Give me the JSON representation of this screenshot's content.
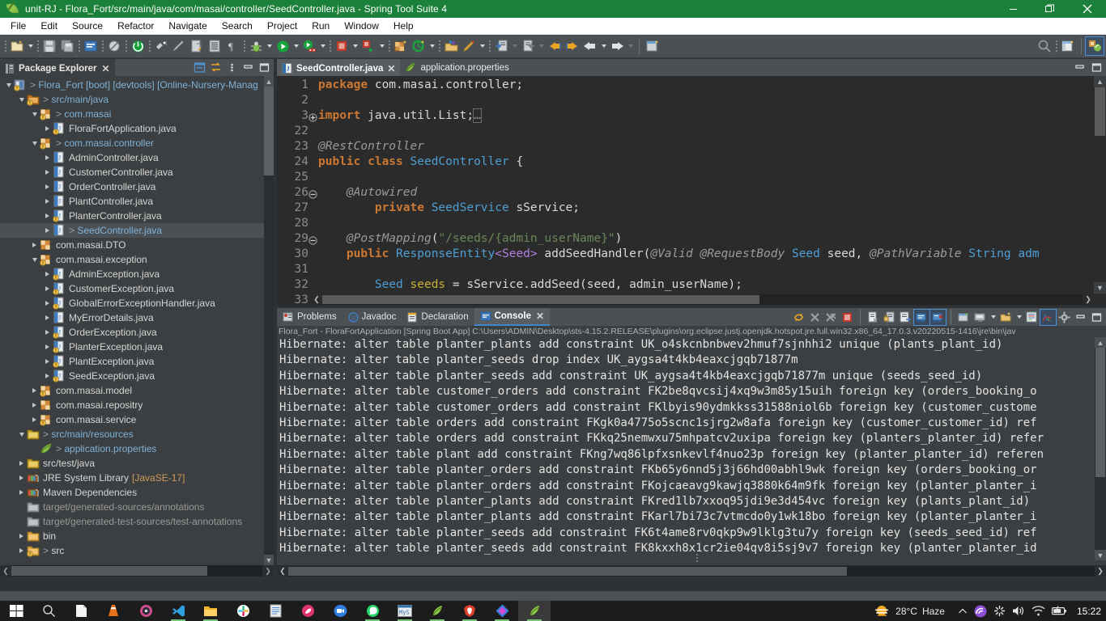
{
  "window": {
    "title": "unit-RJ - Flora_Fort/src/main/java/com/masai/controller/SeedController.java - Spring Tool Suite 4",
    "minimize": "—",
    "restore": "❐",
    "close": "✕"
  },
  "menu": [
    "File",
    "Edit",
    "Source",
    "Refactor",
    "Navigate",
    "Search",
    "Project",
    "Run",
    "Window",
    "Help"
  ],
  "package_explorer": {
    "tab_label": "Package Explorer",
    "close_label": "✕",
    "tree": [
      {
        "depth": 0,
        "twisty": "down",
        "icon": "project",
        "label": "Flora_Fort [boot] [devtools] [Online-Nursery-Manag",
        "style": "link",
        "dirty": true
      },
      {
        "depth": 1,
        "twisty": "down",
        "icon": "srcfolder",
        "label": "src/main/java",
        "style": "link",
        "dirty": true
      },
      {
        "depth": 2,
        "twisty": "down",
        "icon": "pkg-warn",
        "label": "com.masai",
        "style": "link",
        "dirty": true
      },
      {
        "depth": 3,
        "twisty": "right",
        "icon": "java-warn",
        "label": "FloraFortApplication.java",
        "style": "plain",
        "dirty": false
      },
      {
        "depth": 2,
        "twisty": "down",
        "icon": "pkg-warn",
        "label": "com.masai.controller",
        "style": "link",
        "dirty": true
      },
      {
        "depth": 3,
        "twisty": "right",
        "icon": "java",
        "label": "AdminController.java",
        "style": "plain",
        "dirty": false
      },
      {
        "depth": 3,
        "twisty": "right",
        "icon": "java",
        "label": "CustomerController.java",
        "style": "plain",
        "dirty": false
      },
      {
        "depth": 3,
        "twisty": "right",
        "icon": "java",
        "label": "OrderController.java",
        "style": "plain",
        "dirty": false
      },
      {
        "depth": 3,
        "twisty": "right",
        "icon": "java",
        "label": "PlantController.java",
        "style": "plain",
        "dirty": false
      },
      {
        "depth": 3,
        "twisty": "right",
        "icon": "java-warn",
        "label": "PlanterController.java",
        "style": "plain",
        "dirty": false
      },
      {
        "depth": 3,
        "twisty": "right",
        "icon": "java",
        "label": "SeedController.java",
        "style": "link",
        "dirty": true,
        "selected": true
      },
      {
        "depth": 2,
        "twisty": "right",
        "icon": "pkg",
        "label": "com.masai.DTO",
        "style": "plain",
        "dirty": false
      },
      {
        "depth": 2,
        "twisty": "down",
        "icon": "pkg-warn",
        "label": "com.masai.exception",
        "style": "plain",
        "dirty": false
      },
      {
        "depth": 3,
        "twisty": "right",
        "icon": "java-warn",
        "label": "AdminException.java",
        "style": "plain",
        "dirty": false
      },
      {
        "depth": 3,
        "twisty": "right",
        "icon": "java-warn",
        "label": "CustomerException.java",
        "style": "plain",
        "dirty": false
      },
      {
        "depth": 3,
        "twisty": "right",
        "icon": "java-warn",
        "label": "GlobalErrorExceptionHandler.java",
        "style": "plain",
        "dirty": false
      },
      {
        "depth": 3,
        "twisty": "right",
        "icon": "java",
        "label": "MyErrorDetails.java",
        "style": "plain",
        "dirty": false
      },
      {
        "depth": 3,
        "twisty": "right",
        "icon": "java-warn",
        "label": "OrderException.java",
        "style": "plain",
        "dirty": false
      },
      {
        "depth": 3,
        "twisty": "right",
        "icon": "java-warn",
        "label": "PlanterException.java",
        "style": "plain",
        "dirty": false
      },
      {
        "depth": 3,
        "twisty": "right",
        "icon": "java-warn",
        "label": "PlantException.java",
        "style": "plain",
        "dirty": false
      },
      {
        "depth": 3,
        "twisty": "right",
        "icon": "java-warn",
        "label": "SeedException.java",
        "style": "plain",
        "dirty": false
      },
      {
        "depth": 2,
        "twisty": "right",
        "icon": "pkg-warn",
        "label": "com.masai.model",
        "style": "plain",
        "dirty": false
      },
      {
        "depth": 2,
        "twisty": "right",
        "icon": "pkg",
        "label": "com.masai.repositry",
        "style": "plain",
        "dirty": false
      },
      {
        "depth": 2,
        "twisty": "right",
        "icon": "pkg-warn",
        "label": "com.masai.service",
        "style": "plain",
        "dirty": false
      },
      {
        "depth": 1,
        "twisty": "down",
        "icon": "resfolder",
        "label": "src/main/resources",
        "style": "link",
        "dirty": true
      },
      {
        "depth": 2,
        "twisty": "none",
        "icon": "props",
        "label": "application.properties",
        "style": "link",
        "dirty": true
      },
      {
        "depth": 1,
        "twisty": "right",
        "icon": "resfolder",
        "label": "src/test/java",
        "style": "plain",
        "dirty": false
      },
      {
        "depth": 1,
        "twisty": "right",
        "icon": "library",
        "label": "JRE System Library",
        "suffix": "[JavaSE-17]",
        "style": "plain",
        "dirty": false
      },
      {
        "depth": 1,
        "twisty": "right",
        "icon": "library",
        "label": "Maven Dependencies",
        "style": "plain",
        "dirty": false
      },
      {
        "depth": 1,
        "twisty": "none",
        "icon": "genfolder",
        "label": "target/generated-sources/annotations",
        "style": "dim",
        "dirty": false
      },
      {
        "depth": 1,
        "twisty": "none",
        "icon": "genfolder",
        "label": "target/generated-test-sources/test-annotations",
        "style": "dim",
        "dirty": false
      },
      {
        "depth": 1,
        "twisty": "right",
        "icon": "folder",
        "label": "bin",
        "style": "plain",
        "dirty": false
      },
      {
        "depth": 1,
        "twisty": "right",
        "icon": "folder-warn",
        "label": "src",
        "style": "plain",
        "dirty": true
      }
    ]
  },
  "editor": {
    "tabs": [
      {
        "label": "SeedController.java",
        "icon": "java-file-icon",
        "active": true,
        "closable": true
      },
      {
        "label": "application.properties",
        "icon": "properties-file-icon",
        "active": false,
        "closable": false
      }
    ],
    "lines": [
      {
        "num": "1",
        "marker": "",
        "html": "<span class=\"k-kw\">package</span> com.masai.controller;"
      },
      {
        "num": "2",
        "marker": "",
        "html": ""
      },
      {
        "num": "3",
        "marker": "plus",
        "html": "<span class=\"k-kw\">import</span> java.util.List;<span style=\"outline:1px solid #6b6b6b;color:#8a8a8a\">&#8230;</span>"
      },
      {
        "num": "22",
        "marker": "",
        "html": ""
      },
      {
        "num": "23",
        "marker": "",
        "html": "<span class=\"k-ann\">@RestController</span>"
      },
      {
        "num": "24",
        "marker": "",
        "html": "<span class=\"k-kw\">public class</span> <span class=\"k-type\">SeedController</span> {"
      },
      {
        "num": "25",
        "marker": "",
        "html": ""
      },
      {
        "num": "26",
        "marker": "minus",
        "html": "    <span class=\"k-ann\">@Autowired</span>"
      },
      {
        "num": "27",
        "marker": "",
        "html": "        <span class=\"k-kw\">private</span> <span class=\"k-type\">SeedService</span> sService;"
      },
      {
        "num": "28",
        "marker": "",
        "html": ""
      },
      {
        "num": "29",
        "marker": "minus",
        "html": "    <span class=\"k-ann\">@PostMapping</span>(<span class=\"k-str\">\"/seeds/{admin_userName}\"</span>)"
      },
      {
        "num": "30",
        "marker": "",
        "html": "    <span class=\"k-kw\">public</span> <span class=\"k-type\">ResponseEntity</span><span class=\"k-gen\">&lt;Seed&gt;</span> addSeedHandler(<span class=\"k-ann\">@Valid</span> <span class=\"k-ann\">@RequestBody</span> <span class=\"k-type\">Seed</span> seed, <span class=\"k-ann\">@PathVariable</span> <span class=\"k-type\">String</span> <span class=\"k-type\">adm</span>"
      },
      {
        "num": "31",
        "marker": "",
        "html": ""
      },
      {
        "num": "32",
        "marker": "",
        "html": "        <span class=\"k-type\">Seed</span> <span class=\"k-fld\">seeds</span> = sService.addSeed(seed, admin_userName);"
      },
      {
        "num": "33",
        "marker": "",
        "html": ""
      }
    ]
  },
  "console": {
    "tabs": [
      {
        "label": "Problems",
        "icon": "problems-icon",
        "active": false
      },
      {
        "label": "Javadoc",
        "icon": "javadoc-icon",
        "active": false
      },
      {
        "label": "Declaration",
        "icon": "declaration-icon",
        "active": false
      },
      {
        "label": "Console",
        "icon": "console-icon",
        "active": true,
        "closable": true
      }
    ],
    "close_label": "✕",
    "process_line": "Flora_Fort - FloraFortApplication [Spring Boot App] C:\\Users\\ADMIN\\Desktop\\sts-4.15.2.RELEASE\\plugins\\org.eclipse.justj.openjdk.hotspot.jre.full.win32.x86_64_17.0.3.v20220515-1416\\jre\\bin\\jav",
    "output": [
      "Hibernate: alter table planter_plants add constraint UK_o4skcnbnbwev2hmuf7sjnhhi2 unique (plants_plant_id)",
      "Hibernate: alter table planter_seeds drop index UK_aygsa4t4kb4eaxcjgqb71877m",
      "Hibernate: alter table planter_seeds add constraint UK_aygsa4t4kb4eaxcjgqb71877m unique (seeds_seed_id)",
      "Hibernate: alter table customer_orders add constraint FK2be8qvcsij4xq9w3m85y15uih foreign key (orders_booking_o",
      "Hibernate: alter table customer_orders add constraint FKlbyis90ydmkkss31588niol6b foreign key (customer_custome",
      "Hibernate: alter table orders add constraint FKgk0a4775o5scnc1sjrg2w8afa foreign key (customer_customer_id) ref",
      "Hibernate: alter table orders add constraint FKkq25nemwxu75mhpatcv2uxipa foreign key (planters_planter_id) refer",
      "Hibernate: alter table plant add constraint FKng7wq86lpfxsnkevlf4nuo23p foreign key (planter_planter_id) referen",
      "Hibernate: alter table planter_orders add constraint FKb65y6nnd5j3j66hd00abhl9wk foreign key (orders_booking_or",
      "Hibernate: alter table planter_orders add constraint FKojcaeavg9kawjq3880k64m9fk foreign key (planter_planter_i",
      "Hibernate: alter table planter_plants add constraint FKred1lb7xxoq95jdi9e3d454vc foreign key (plants_plant_id)",
      "Hibernate: alter table planter_plants add constraint FKarl7bi73c7vtmcdo0y1wk18bo foreign key (planter_planter_i",
      "Hibernate: alter table planter_seeds add constraint FK6t4ame8rv0qkp9w9lklg3tu7y foreign key (seeds_seed_id) ref",
      "Hibernate: alter table planter_seeds add constraint FK8kxxh8x1cr2ie04qv8i5sj9v7 foreign key (planter_planter_id"
    ]
  },
  "taskbar": {
    "items": [
      {
        "name": "start-button",
        "icon": "windows-logo-icon"
      },
      {
        "name": "search-button",
        "icon": "search-icon"
      },
      {
        "name": "task-file-explorer-doc",
        "icon": "document-icon"
      },
      {
        "name": "task-vlc",
        "icon": "vlc-cone-icon"
      },
      {
        "name": "task-media-player",
        "icon": "media-player-icon"
      },
      {
        "name": "task-vscode",
        "icon": "vscode-icon",
        "running": true
      },
      {
        "name": "task-file-explorer",
        "icon": "folder-icon",
        "running": true
      },
      {
        "name": "task-slack",
        "icon": "slack-icon"
      },
      {
        "name": "task-notepad",
        "icon": "notepad-icon"
      },
      {
        "name": "task-postman",
        "icon": "postman-icon"
      },
      {
        "name": "task-zoom",
        "icon": "zoom-icon"
      },
      {
        "name": "task-whatsapp",
        "icon": "whatsapp-icon",
        "running": true
      },
      {
        "name": "task-mysql-workbench",
        "icon": "mysql-icon",
        "running": true
      },
      {
        "name": "task-sts-other",
        "icon": "spring-leaf-icon",
        "running": true
      },
      {
        "name": "task-brave",
        "icon": "brave-icon",
        "running": true
      },
      {
        "name": "task-other-app",
        "icon": "diamond-icon",
        "running": true
      },
      {
        "name": "task-spring-tool-suite",
        "icon": "spring-leaf-icon",
        "running": true,
        "active": true
      }
    ],
    "tray": {
      "weather_temp": "28°C",
      "weather_desc": "Haze",
      "chevron": "∧",
      "clock": "15:22"
    }
  }
}
